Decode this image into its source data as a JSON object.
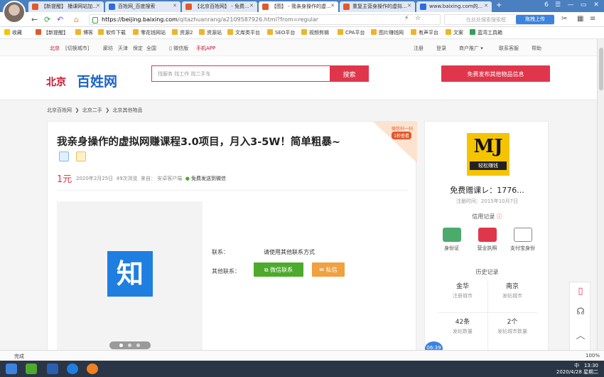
{
  "tabs": [
    {
      "label": "【新提醒】 播课网站加...",
      "color": "#e05a2b"
    },
    {
      "label": "百姓网_百度搜索",
      "color": "#2b6de0"
    },
    {
      "label": "【北京百姓网】 - 免费...",
      "color": "#e05a2b"
    },
    {
      "label": "【图】 - 我亲身操作的虚...",
      "color": "#e05a2b"
    },
    {
      "label": "重复主营身操作的虚拟...",
      "color": "#e05a2b"
    },
    {
      "label": "www.baixing.com的...",
      "color": "#2b6de0"
    }
  ],
  "window_controls": [
    "6",
    "☰",
    "—",
    "▭",
    "✕"
  ],
  "nav": {
    "url_host": "https://beijing.baixing.com",
    "url_path": "/qitazhuanrang/a2109587926.html?from=regular",
    "search_placeholder": "在此处搜索搜索框",
    "search_btn": "拖拽上传"
  },
  "bookmarks": [
    "收藏",
    "【新提醒】",
    "博客",
    "软件下载",
    "零花钱网站",
    "资源2",
    "资源站",
    "文库类平台",
    "SEO平台",
    "视频剪辑",
    "CPA平台",
    "图片赚钱网",
    "有声平台",
    "文案",
    "蓝湾工具箱"
  ],
  "sitebar": {
    "left": [
      "北京",
      "[切换城市]",
      "廊坊",
      "天津",
      "保定",
      "全国",
      "微信版",
      "手机APP"
    ],
    "right": [
      "注册",
      "登录",
      "商户推广",
      "联系客服",
      "帮助"
    ]
  },
  "header": {
    "logo_city": "北京",
    "logo_brand": "百姓网",
    "search_placeholder": "找服务 找工作 找二手车",
    "search_button": "搜索",
    "post_button": "免费发布其他物品信息"
  },
  "breadcrumb": [
    "北京百姓网",
    "北京二手",
    "北京其他物品"
  ],
  "listing": {
    "title": "我亲身操作的虚拟网赚课程3.0项目，月入3-5W！简单粗暴~",
    "corner_line1": "微信扫一扫",
    "corner_line2": "1秒查看",
    "price": "1元",
    "date": "2020年2月25日",
    "views": "49次浏览",
    "source_label": "来自：",
    "source": "安卓客户端",
    "wechat_send": "免费发送到微信",
    "image_text": "知",
    "contact_label": "联系：",
    "contact_value": "请使用其他联系方式",
    "other_label": "其他联系：",
    "wechat_btn": "微信联系",
    "pm_btn": "私信"
  },
  "seller": {
    "logo_text": "MJ",
    "logo_sub": "轻松赚钱",
    "name": "免费赠课レ：1776...",
    "reg_date": "注册时间：2015年10月7日",
    "credit_title": "信用记录",
    "credits": [
      {
        "label": "身份证",
        "color": "#4caa6c"
      },
      {
        "label": "营业执照",
        "color": "#e0364b"
      },
      {
        "label": "支付宝身份",
        "color": "#888888"
      }
    ],
    "history_title": "历史记录",
    "history": [
      {
        "value": "金华",
        "label": "注册城市"
      },
      {
        "value": "南京",
        "label": "发帖城市"
      },
      {
        "value": "42条",
        "label": "发帖数量"
      },
      {
        "value": "2个",
        "label": "发帖城市数量"
      }
    ]
  },
  "float_icons": [
    "phone-icon",
    "headset-icon",
    "chevron-up-icon",
    "message-icon"
  ],
  "clock_badge": "06:39",
  "status": {
    "text": "完成",
    "zoom": "100%"
  },
  "tray": {
    "time": "13:30",
    "date": "2020/4/28 星期二",
    "ime": "中"
  }
}
